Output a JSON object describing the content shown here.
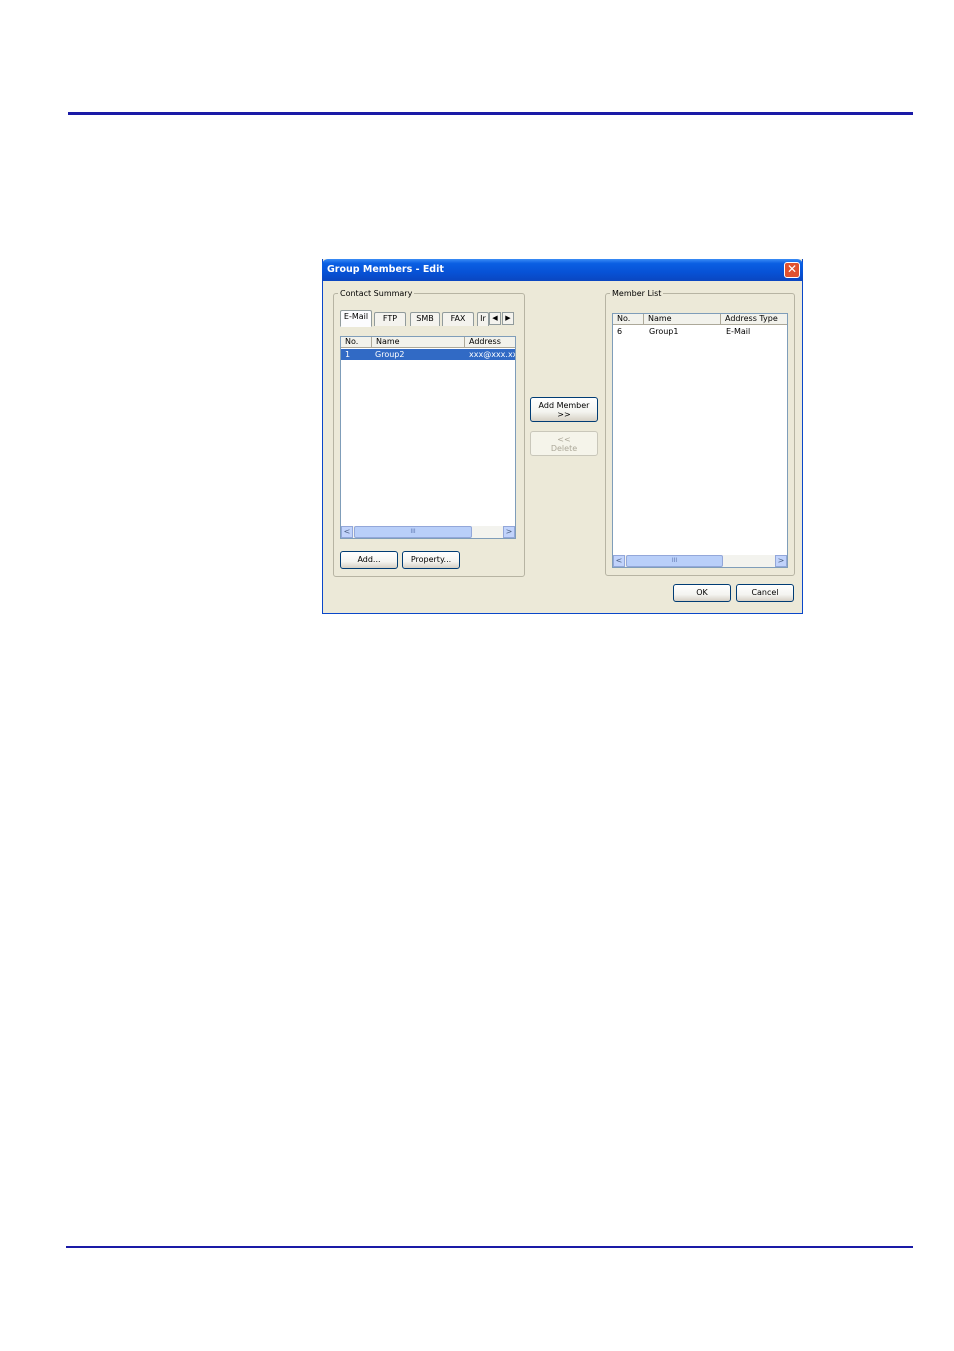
{
  "dialog": {
    "title": "Group Members - Edit",
    "close_glyph": "✕",
    "contact_summary": {
      "label": "Contact Summary",
      "tabs": [
        "E-Mail",
        "FTP",
        "SMB",
        "FAX",
        "Ir"
      ],
      "active_tab": "E-Mail",
      "columns": [
        "No.",
        "Name",
        "Address"
      ],
      "rows": [
        {
          "no": "1",
          "name": "Group2",
          "address": "xxx@xxx.xx",
          "selected": true
        }
      ],
      "add_label": "Add...",
      "property_label": "Property..."
    },
    "add_member_label": "Add Member",
    "add_member_arrows": ">>",
    "delete_arrows": "<<",
    "delete_label": "Delete",
    "member_list": {
      "label": "Member List",
      "columns": [
        "No.",
        "Name",
        "Address Type"
      ],
      "rows": [
        {
          "no": "6",
          "name": "Group1",
          "type": "E-Mail"
        }
      ]
    },
    "ok_label": "OK",
    "cancel_label": "Cancel"
  },
  "glyphs": {
    "scroll_left": "<",
    "scroll_right": ">",
    "tab_left": "◀",
    "tab_right": "▶",
    "thumb_grip": "III"
  }
}
